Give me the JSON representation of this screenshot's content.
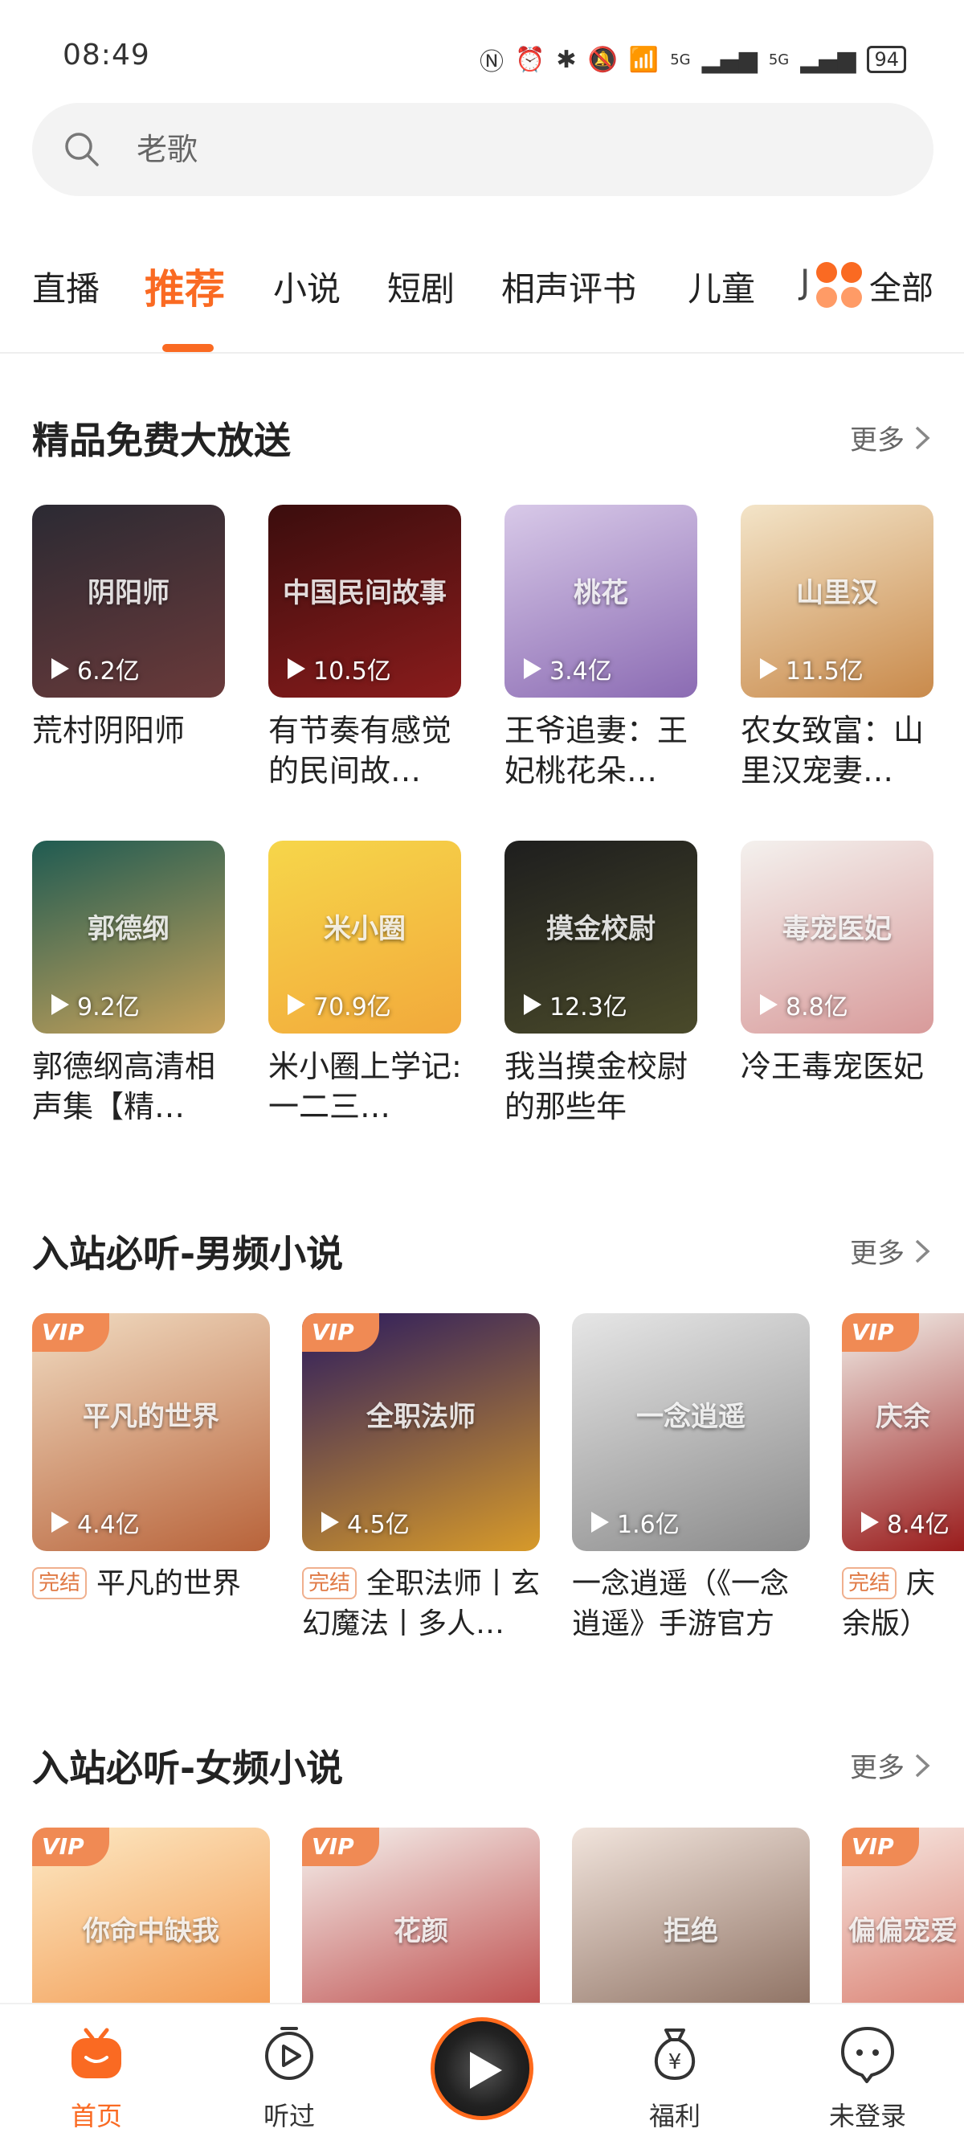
{
  "status_bar": {
    "time": "08:49",
    "battery": "94",
    "net1": "5G",
    "net2": "5G"
  },
  "search": {
    "placeholder": "老歌"
  },
  "tabs": [
    {
      "label": "直播"
    },
    {
      "label": "推荐"
    },
    {
      "label": "小说"
    },
    {
      "label": "短剧"
    },
    {
      "label": "相声评书"
    },
    {
      "label": "儿童"
    },
    {
      "label": "J"
    }
  ],
  "tabs_all_label": "全部",
  "sections": [
    {
      "title": "精品免费大放送",
      "more": "更多",
      "items": [
        {
          "title": "荒村阴阳师",
          "plays": "6.2亿",
          "color1": "#2b2a33",
          "color2": "#6a3a3a",
          "art_text": "阴阳师"
        },
        {
          "title": "有节奏有感觉的民间故…",
          "plays": "10.5亿",
          "color1": "#3b0d0d",
          "color2": "#8a1c1c",
          "art_text": "中国民间故事"
        },
        {
          "title": "王爷追妻：王妃桃花朵…",
          "plays": "3.4亿",
          "color1": "#d8c9e8",
          "color2": "#8b6bb3",
          "art_text": "桃花"
        },
        {
          "title": "农女致富：山里汉宠妻…",
          "plays": "11.5亿",
          "color1": "#f3e4c8",
          "color2": "#c98a4b",
          "art_text": "山里汉"
        },
        {
          "title": "郭德纲高清相声集【精…",
          "plays": "9.2亿",
          "color1": "#1f5b52",
          "color2": "#c8a25a",
          "art_text": "郭德纲"
        },
        {
          "title": "米小圈上学记:一二三…",
          "plays": "70.9亿",
          "color1": "#f6d64a",
          "color2": "#f2a93b",
          "art_text": "米小圈"
        },
        {
          "title": "我当摸金校尉的那些年",
          "plays": "12.3亿",
          "color1": "#1e1e1e",
          "color2": "#4a4a2a",
          "art_text": "摸金校尉"
        },
        {
          "title": "冷王毒宠医妃",
          "plays": "8.8亿",
          "color1": "#f4f1ee",
          "color2": "#d89a9a",
          "art_text": "毒宠医妃"
        }
      ]
    },
    {
      "title": "入站必听-男频小说",
      "more": "更多",
      "badge": "完结",
      "items": [
        {
          "title": "平凡的世界",
          "plays": "4.4亿",
          "vip": "VIP",
          "done": true,
          "color1": "#f1dcc2",
          "color2": "#b8633a",
          "art_text": "平凡的世界"
        },
        {
          "title": "全职法师丨玄幻魔法丨多人…",
          "plays": "4.5亿",
          "vip": "VIP",
          "done": true,
          "color1": "#2b1b5e",
          "color2": "#d79a2a",
          "art_text": "全职法师"
        },
        {
          "title": "一念逍遥（《一念逍遥》手游官方小…",
          "plays": "1.6亿",
          "vip": "",
          "done": false,
          "color1": "#e6e6e6",
          "color2": "#8a8a8a",
          "art_text": "一念逍遥"
        },
        {
          "title": "庆余版）",
          "plays": "8.4亿",
          "vip": "VIP",
          "done": true,
          "color1": "#f2efe9",
          "color2": "#9a1c1c",
          "art_text": "庆余"
        }
      ]
    },
    {
      "title": "入站必听-女频小说",
      "more": "更多",
      "items": [
        {
          "vip": "VIP",
          "color1": "#fde9c4",
          "color2": "#f08a3a",
          "art_text": "你命中缺我"
        },
        {
          "vip": "VIP",
          "color1": "#f6f3ef",
          "color2": "#b22a2a",
          "art_text": "花颜"
        },
        {
          "vip": "",
          "color1": "#f1e4dc",
          "color2": "#7a5a4a",
          "art_text": "拒绝"
        },
        {
          "vip": "VIP",
          "color1": "#f7e8e2",
          "color2": "#d46a5a",
          "art_text": "偏偏宠爱"
        }
      ]
    }
  ],
  "bottom_nav": [
    {
      "label": "首页"
    },
    {
      "label": "听过"
    },
    {
      "label": ""
    },
    {
      "label": "福利"
    },
    {
      "label": "未登录"
    }
  ],
  "colors": {
    "accent": "#fa6a22"
  }
}
